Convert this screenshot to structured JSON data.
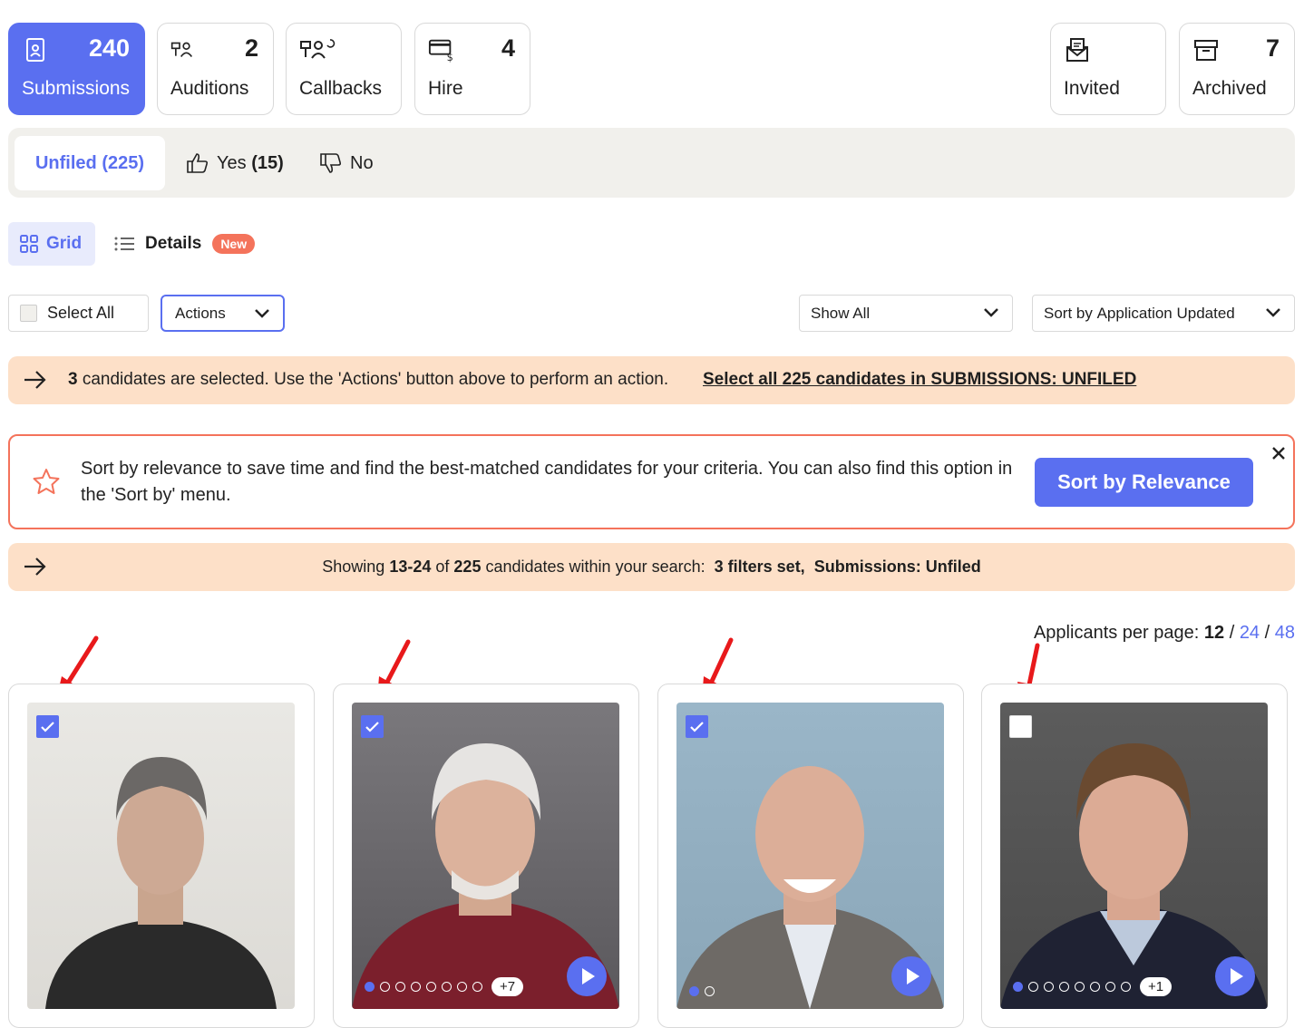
{
  "stages": [
    {
      "label": "Submissions",
      "count": "240",
      "icon": "submissions-icon",
      "active": true
    },
    {
      "label": "Auditions",
      "count": "2",
      "icon": "auditions-icon"
    },
    {
      "label": "Callbacks",
      "count": "",
      "icon": "callbacks-icon"
    },
    {
      "label": "Hire",
      "count": "4",
      "icon": "hire-icon"
    },
    {
      "label": "Invited",
      "count": "",
      "icon": "invited-icon"
    },
    {
      "label": "Archived",
      "count": "7",
      "icon": "archive-icon"
    }
  ],
  "filter_tabs": {
    "unfiled": "Unfiled (225)",
    "yes_label": "Yes",
    "yes_count": "(15)",
    "no_label": "No"
  },
  "view": {
    "grid_label": "Grid",
    "details_label": "Details",
    "new_badge": "New"
  },
  "controls": {
    "select_all": "Select All",
    "actions": "Actions",
    "show_all": "Show All",
    "sort_prefix": "Sort by",
    "sort_value": "Application Updated"
  },
  "selection_banner": {
    "count": "3",
    "text": "candidates are selected. Use the 'Actions' button above to perform an action.",
    "link": "Select all 225 candidates in SUBMISSIONS: UNFILED"
  },
  "promo": {
    "text": "Sort by relevance to save time and find the best-matched candidates for your criteria. You can also find this option in the 'Sort by' menu.",
    "button": "Sort by Relevance"
  },
  "results_banner": {
    "prefix": "Showing",
    "range": "13-24",
    "of": "of",
    "total": "225",
    "suffix": "candidates within your search:",
    "filters": "3 filters set,",
    "scope": "Submissions: Unfiled"
  },
  "per_page": {
    "label": "Applicants per page:",
    "current": "12",
    "sep1": "/",
    "opt2": "24",
    "sep2": "/",
    "opt3": "48"
  },
  "cards": [
    {
      "checked": true,
      "dots": 0,
      "extra": "",
      "video": false
    },
    {
      "checked": true,
      "dots": 8,
      "extra": "+7",
      "video": true
    },
    {
      "checked": true,
      "dots": 2,
      "extra": "",
      "video": true
    },
    {
      "checked": false,
      "dots": 8,
      "extra": "+1",
      "video": true
    }
  ],
  "colors": {
    "accent": "#5a6ff0",
    "banner": "#fde0c8",
    "promo_border": "#f4735b"
  }
}
